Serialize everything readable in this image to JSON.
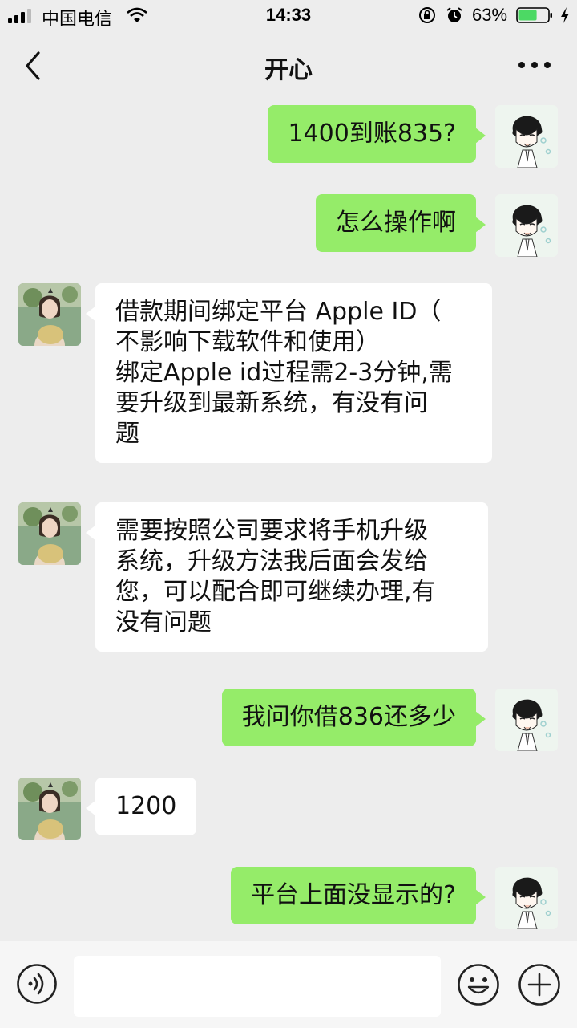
{
  "status": {
    "carrier": "中国电信",
    "time": "14:33",
    "battery_percent": "63%",
    "battery_level": 0.63,
    "battery_color": "#4cd964"
  },
  "header": {
    "title": "开心",
    "back_icon": "chevron-left-icon",
    "more_icon": "more-dots-icon"
  },
  "messages": [
    {
      "sender": "me",
      "text": "1400到账835?"
    },
    {
      "sender": "me",
      "text": "怎么操作啊"
    },
    {
      "sender": "them",
      "text": "借款期间绑定平台 Apple ID（\n不影响下载软件和使用）\n绑定Apple id过程需2-3分钟,需\n要升级到最新系统，有没有问\n题"
    },
    {
      "sender": "them",
      "text": "需要按照公司要求将手机升级\n系统，升级方法我后面会发给\n您，可以配合即可继续办理,有\n没有问题"
    },
    {
      "sender": "me",
      "text": "我问你借836还多少"
    },
    {
      "sender": "them",
      "text": "1200"
    },
    {
      "sender": "me",
      "text": "平台上面没显示的?"
    }
  ],
  "input_bar": {
    "placeholder": "",
    "voice_icon": "voice-icon",
    "emoji_icon": "emoji-icon",
    "plus_icon": "plus-circle-icon"
  },
  "colors": {
    "background": "#ededed",
    "my_bubble": "#95ec69",
    "their_bubble": "#ffffff"
  }
}
